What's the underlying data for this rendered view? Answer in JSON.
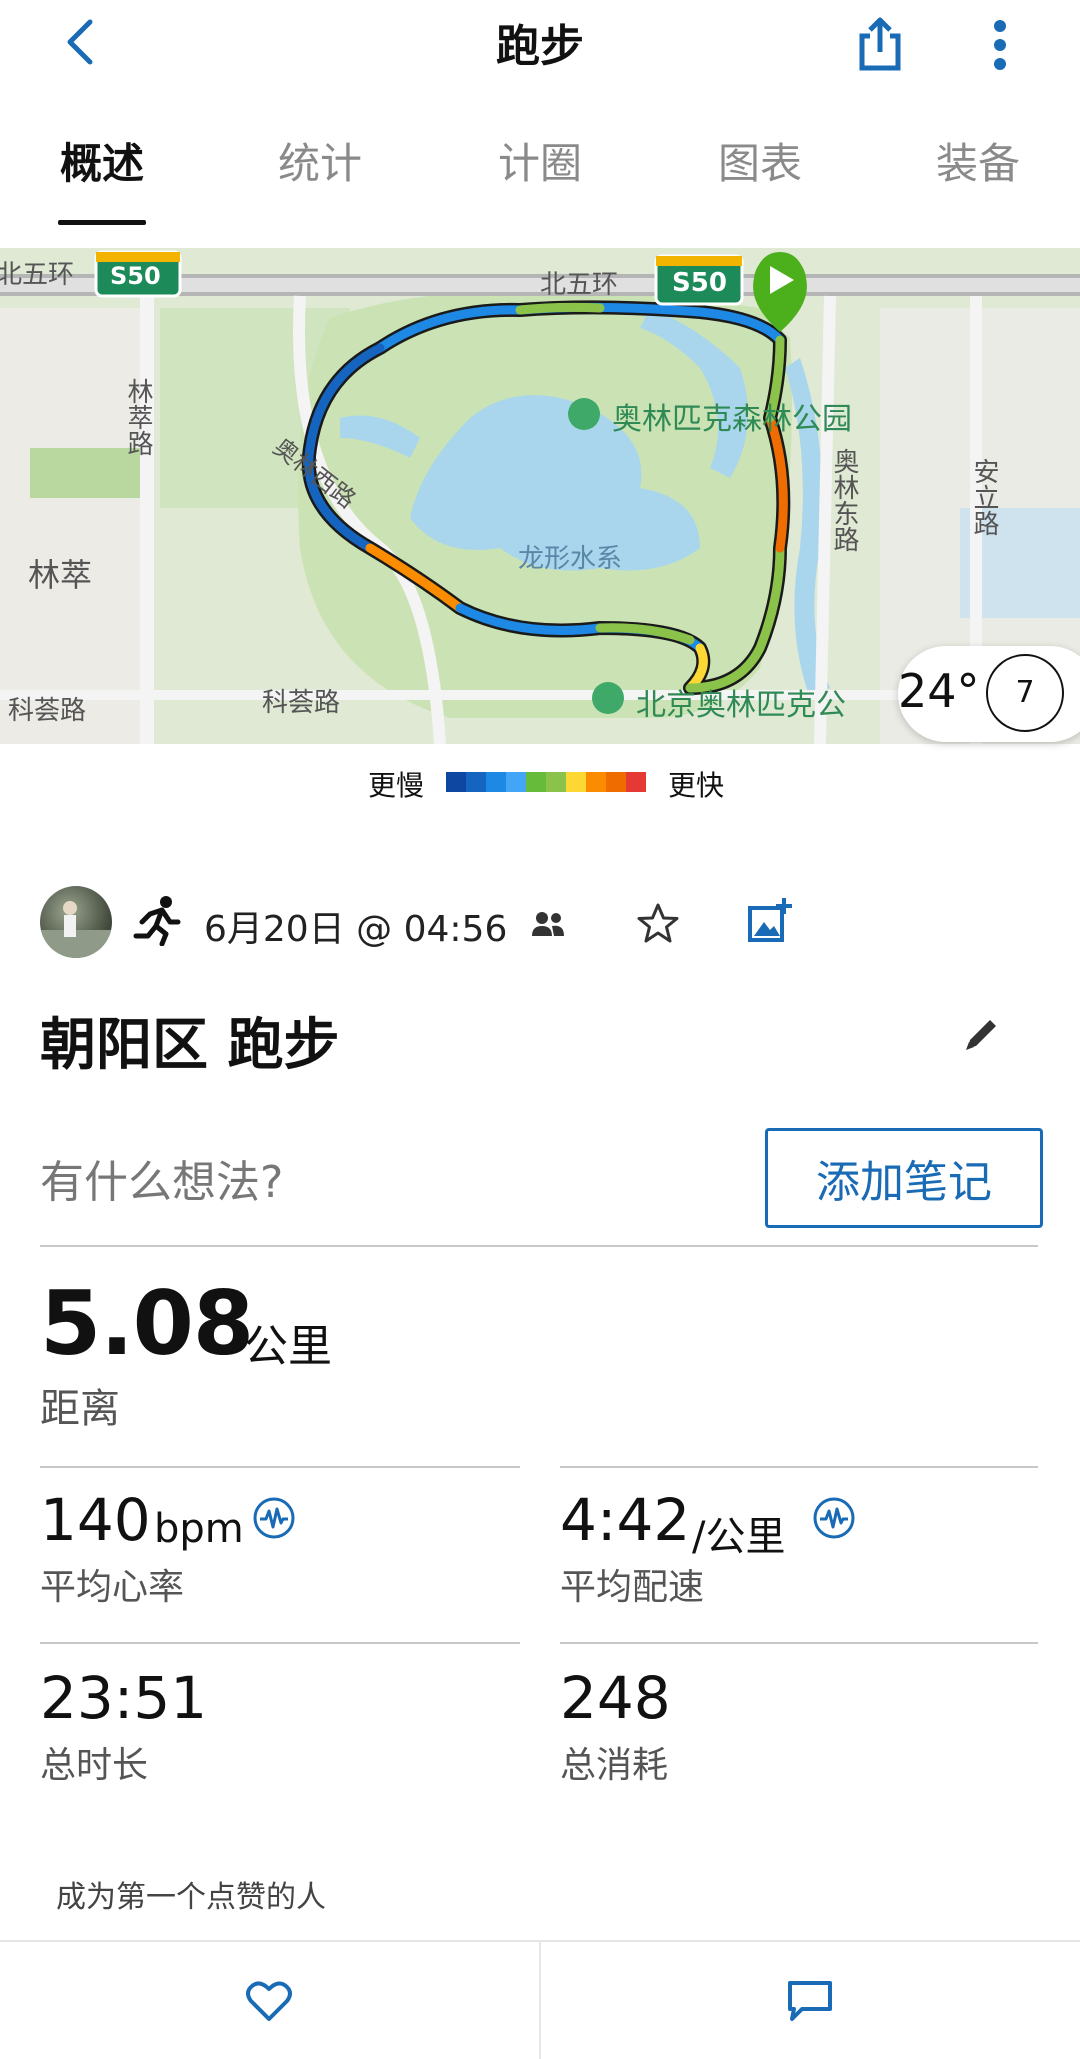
{
  "header": {
    "title": "跑步"
  },
  "tabs": [
    "概述",
    "统计",
    "计圈",
    "图表",
    "装备"
  ],
  "map": {
    "labels": {
      "ring_left": "北五环",
      "ring_mid": "北五环",
      "s50_a": "S50",
      "s50_b": "S50",
      "linc_road": "林萃路",
      "aolin_west": "奥林西路",
      "park": "奥林匹克森林公园",
      "aolin_east": "奥林东路",
      "anli": "安立路",
      "lincui": "林萃",
      "water": "龙形水系",
      "kehui1": "科荟路",
      "kehui2": "科荟路",
      "bj_park": "北京奥林匹克公"
    },
    "weather": {
      "temp": "24°",
      "wind": "7"
    }
  },
  "legend": {
    "slow": "更慢",
    "fast": "更快",
    "colors": [
      "#0d47a1",
      "#1565c0",
      "#1e88e5",
      "#42a5f5",
      "#66bb3a",
      "#8bc34a",
      "#fdd835",
      "#fb8c00",
      "#ef6c00",
      "#e53935"
    ]
  },
  "meta": {
    "date": "6月20日 @ 04:56"
  },
  "activity": {
    "title": "朝阳区 跑步",
    "thoughts_placeholder": "有什么想法?",
    "add_note": "添加笔记"
  },
  "stats": {
    "distance": {
      "value": "5.08",
      "unit": "公里",
      "label": "距离"
    },
    "heart_rate": {
      "value": "140",
      "unit": "bpm",
      "label": "平均心率"
    },
    "pace": {
      "value": "4:42",
      "unit": "/公里",
      "label": "平均配速"
    },
    "duration": {
      "value": "23:51",
      "label": "总时长"
    },
    "calories": {
      "value": "248",
      "label": "总消耗"
    }
  },
  "social": {
    "likes_text": "成为第一个点赞的人"
  },
  "colors": {
    "accent": "#1a6bb5"
  }
}
